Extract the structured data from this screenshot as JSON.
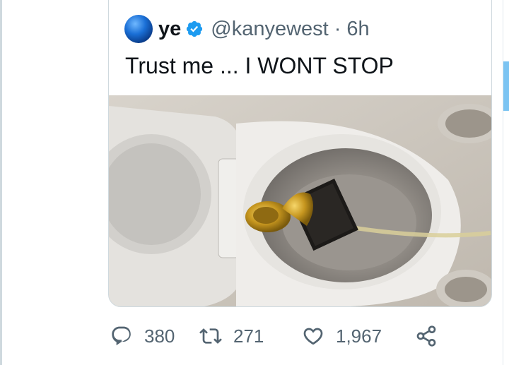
{
  "tweet": {
    "display_name": "ye",
    "handle": "@kanyewest",
    "separator": "·",
    "time": "6h",
    "text": "Trust me ... I WONT STOP"
  },
  "media": {
    "description_icon": "toilet-photo"
  },
  "actions": {
    "replies": "380",
    "retweets": "271",
    "likes": "1,967"
  },
  "colors": {
    "verified": "#1d9bf0",
    "muted": "#536471",
    "border": "#cfd9de",
    "text": "#0f1419"
  }
}
